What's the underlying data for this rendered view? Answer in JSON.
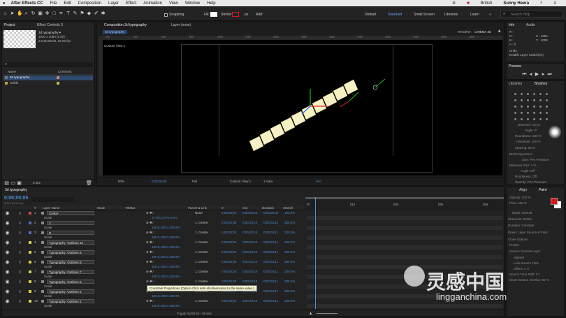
{
  "menubar": {
    "app": "After Effects CC",
    "items": [
      "File",
      "Edit",
      "Composition",
      "Layer",
      "Effect",
      "Animation",
      "View",
      "Window",
      "Help"
    ],
    "user": "Sunny Heera",
    "lang": "British"
  },
  "toolbar": {
    "snapping": "Snapping",
    "fill": "Fill:",
    "stroke": "Stroke:",
    "stroke_px": "px",
    "add": "Add:",
    "workspaces": [
      "Default",
      "Standard",
      "Small Screen",
      "Libraries",
      "Learn"
    ],
    "search_placeholder": "Search Help"
  },
  "project": {
    "tabs": [
      "Project",
      "Effect Controls 3"
    ],
    "comp_name": "3d typography ▾",
    "comp_info1": "1920 x 1080 (1.00)",
    "comp_info2": "Δ 0;00;06;00, 25.00 fps",
    "search": "⌕",
    "col_name": "Name",
    "col_comment": "Comment",
    "items": [
      "3d typography",
      "Solids"
    ],
    "bpc": "8 bpc"
  },
  "composition": {
    "tab": "Composition 3d typography",
    "layer_tab": "Layer (none)",
    "breadcrumb": "3d typography",
    "renderer_label": "Renderer:",
    "renderer": "CINEMA 4D",
    "view_label": "Custom View 1",
    "zoom": "50%",
    "timecode": "0;00;00;00",
    "quality": "Full",
    "view_select": "Custom View 1",
    "views": "1 View",
    "offset": "+0.0",
    "ruler": [
      "200",
      "400",
      "600",
      "800",
      "1000",
      "1200",
      "1400",
      "1600",
      "1800",
      "2000",
      "2200",
      "2400",
      "2600",
      "2800"
    ]
  },
  "info": {
    "tabs": [
      "Info",
      "Audio"
    ],
    "r": "R :",
    "g": "G :",
    "b": "B :",
    "a": "A : 0",
    "x": "X : 1284",
    "y": "Y : 1008",
    "undo1": "Undo",
    "undo2": "Enable Layer Switch(es)"
  },
  "preview": {
    "title": "Preview"
  },
  "brushes": {
    "tabs": [
      "Libraries",
      "Brushes"
    ],
    "diameter": "Diameter: 13 px",
    "angle": "Angle: 0°",
    "roundness": "Roundness: 100 %",
    "hardness": "Hardness: 100 %",
    "spacing": "Spacing: 25 %",
    "dynamics": "Brush Dynamics",
    "size": "Size: Pen Pressure",
    "min_size": "Minimum Size: 1 %",
    "angle2": "Angle: Off",
    "roundness2": "Roundness: Off",
    "opacity": "Opacity: Pen Pressure",
    "flow": "Flow: Pen Pressure"
  },
  "paint": {
    "tabs": [
      "Align",
      "Paint"
    ],
    "opacity": "Opacity: 100 %",
    "flow": "Flow: 100 %",
    "mode": "Mode: Normal",
    "channels": "Channels: RGBA",
    "duration": "Duration: Constant",
    "erase": "Erase: Layer Source & Paint",
    "clone": "Clone Options",
    "preset": "Preset:",
    "source": "Source: Current Layer",
    "aligned": "Aligned",
    "lock_source": "Lock Source Time",
    "offset": "Offset: 0, 0",
    "source_time": "Source Time Shift: 0 f",
    "clone_overlay": "Clone Source Overlay: 50 %",
    "colors": {
      "fg": "#e0131a",
      "bg": "#ffffff"
    }
  },
  "timeline": {
    "tab": "3d typography",
    "timecode": "0;00;00;05",
    "subcode": "00005 (25.00 fps)",
    "headers": {
      "num": "#",
      "name": "Layer Name",
      "mode": "Mode",
      "trkmat": "TrkMat",
      "parent": "Parent & Link",
      "in": "In",
      "out": "Out",
      "duration": "Duration",
      "stretch": "Stretch"
    },
    "ruler": [
      "0f",
      "01s",
      "02s",
      "03s",
      "04s"
    ],
    "tooltip": "Constrain Proportions (Option-Click sets all dimensions to the same value.)",
    "toggle": "Toggle Switches / Modes",
    "layers": [
      {
        "num": "1",
        "name": "Centre",
        "parent": "None",
        "in": "0;00;00;00",
        "out": "0;00;05;24",
        "dur": "0;00;06;00",
        "stretch": "100.0%",
        "color": "#d04a4a",
        "bar": "#a9434b",
        "prop": "Scale",
        "propval": "2770.0,2770.0,0%"
      },
      {
        "num": "2",
        "name": "3",
        "parent": "1. Centre",
        "in": "0;00;00;00",
        "out": "0;00;03;10",
        "dur": "0;00;03;11",
        "stretch": "100.0%",
        "color": "#5a69c8",
        "bar": "#5a67be",
        "prop": "Scale",
        "propval": "100.0,100.0,100.0%"
      },
      {
        "num": "3",
        "name": "D",
        "parent": "1. Centre",
        "in": "0;00;00;00",
        "out": "0;00;03;10",
        "dur": "0;00;03;11",
        "stretch": "100.0%",
        "color": "#5a69c8",
        "bar": "#5a67be",
        "prop": "Scale",
        "propval": "100.0,100.0,100.0%"
      },
      {
        "num": "4",
        "name": "Typography- Outlines 10",
        "parent": "1. Centre",
        "in": "0;00;00;00",
        "out": "0;00;03;10",
        "dur": "0;00;03;11",
        "stretch": "100.0%",
        "color": "#d8cf4c",
        "bar": "#c9c24a",
        "prop": "Scale",
        "propval": "100.0,100.0,100.0%"
      },
      {
        "num": "5",
        "name": "Typography- Outlines 9",
        "parent": "1. Centre",
        "in": "0;00;00;00",
        "out": "0;00;03;10",
        "dur": "0;00;03;11",
        "stretch": "100.0%",
        "color": "#d8cf4c",
        "bar": "#c9c24a",
        "prop": "Scale",
        "propval": "100.0,100.0,100.0%"
      },
      {
        "num": "6",
        "name": "Typography- Outlines 8",
        "parent": "1. Centre",
        "in": "0;00;00;00",
        "out": "0;00;03;10",
        "dur": "0;00;03;11",
        "stretch": "100.0%",
        "color": "#d8cf4c",
        "bar": "#c9c24a",
        "prop": "Scale",
        "propval": "100.0,100.0,100.0%"
      },
      {
        "num": "7",
        "name": "Typography- Outlines 7",
        "parent": "1. Centre",
        "in": "0;00;00;00",
        "out": "0;00;03;10",
        "dur": "0;00;03;11",
        "stretch": "100.0%",
        "color": "#d8cf4c",
        "bar": "#c9c24a",
        "prop": "Scale",
        "propval": "100.0,100.0,100.0%"
      },
      {
        "num": "8",
        "name": "Typography- Outlines 6",
        "parent": "1. Centre",
        "in": "0;00;00;00",
        "out": "0;00;03;10",
        "dur": "0;00;03;11",
        "stretch": "100.0%",
        "color": "#d8cf4c",
        "bar": "#c9c24a",
        "prop": "Scale",
        "propval": "100.0,100.0,100.0%"
      },
      {
        "num": "9",
        "name": "Typography- Outlines 5",
        "parent": "1. Centre",
        "in": "0;00;00;00",
        "out": "0;00;03;10",
        "dur": "0;00;03;11",
        "stretch": "100.0%",
        "color": "#d8cf4c",
        "bar": "#c9c24a",
        "prop": "Scale",
        "propval": "100.0,100.0,100.0%"
      },
      {
        "num": "10",
        "name": "Typography- Outlines 4",
        "parent": "1. Centre",
        "in": "0;00;00;00",
        "out": "0;00;03;10",
        "dur": "0;00;03;11",
        "stretch": "100.0%",
        "color": "#d8cf4c",
        "bar": "#c9c24a",
        "prop": "Scale",
        "propval": "100.0,100.0,100.0%"
      }
    ]
  },
  "watermark": {
    "cn": "灵感中国",
    "url": "lingganchina.com"
  }
}
